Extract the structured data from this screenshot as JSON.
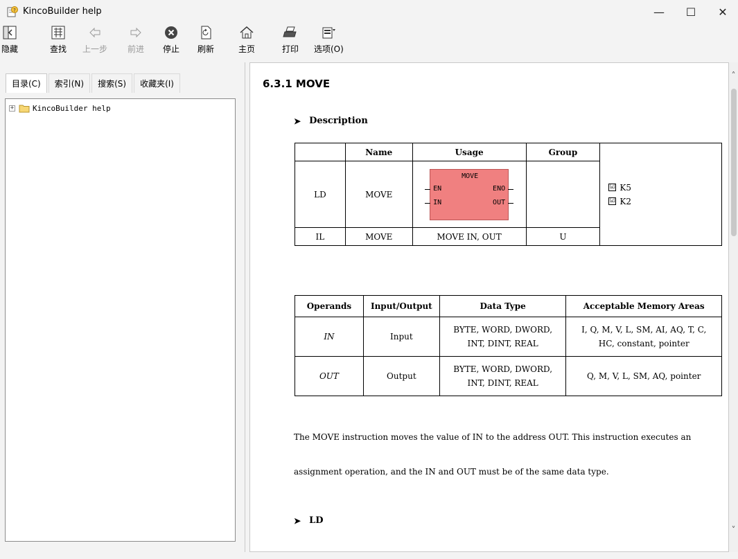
{
  "window": {
    "title": "KincoBuilder help",
    "controls": {
      "minimize": "—",
      "maximize": "☐",
      "close": "✕"
    }
  },
  "toolbar": {
    "hide": "隐藏",
    "find": "查找",
    "back": "上一步",
    "forward": "前进",
    "stop": "停止",
    "refresh": "刷新",
    "home": "主页",
    "print": "打印",
    "options": "选项(O)"
  },
  "left_pane": {
    "tabs": [
      "目录(C)",
      "索引(N)",
      "搜索(S)",
      "收藏夹(I)"
    ],
    "tree": {
      "expander": "+",
      "root_label": "KincoBuilder help"
    }
  },
  "content": {
    "page_title": "6.3.1 MOVE",
    "description_heading": "Description",
    "bullet": "➤",
    "table1": {
      "headers": {
        "name": "Name",
        "usage": "Usage",
        "group": "Group"
      },
      "ld_row": {
        "label": "LD",
        "name": "MOVE"
      },
      "fb": {
        "name": "MOVE",
        "en": "EN",
        "eno": "ENO",
        "in": "IN",
        "out": "OUT"
      },
      "checks": [
        "K5",
        "K2"
      ],
      "check_mark": "☑",
      "il_row": {
        "label": "IL",
        "name": "MOVE",
        "usage": "MOVE IN, OUT",
        "group": "U"
      }
    },
    "table2": {
      "headers": [
        "Operands",
        "Input/Output",
        "Data Type",
        "Acceptable Memory Areas"
      ],
      "rows": [
        {
          "operand": "IN",
          "io": "Input",
          "type_line1": "BYTE, WORD, DWORD,",
          "type_line2": "INT, DINT, REAL",
          "areas_line1": "I, Q, M, V, L, SM, AI, AQ, T, C,",
          "areas_line2": "HC, constant, pointer"
        },
        {
          "operand": "OUT",
          "io": "Output",
          "type_line1": "BYTE, WORD, DWORD,",
          "type_line2": "INT, DINT, REAL",
          "areas_line1": "Q, M, V, L, SM, AQ, pointer",
          "areas_line2": ""
        }
      ]
    },
    "paragraph_line1": "The MOVE instruction moves the value of IN to the address OUT. This instruction executes an",
    "paragraph_line2": "assignment operation, and the IN and OUT must be of the same data type.",
    "ld_heading": "LD"
  },
  "scrollbar": {
    "up": "˄",
    "down": "˅"
  }
}
